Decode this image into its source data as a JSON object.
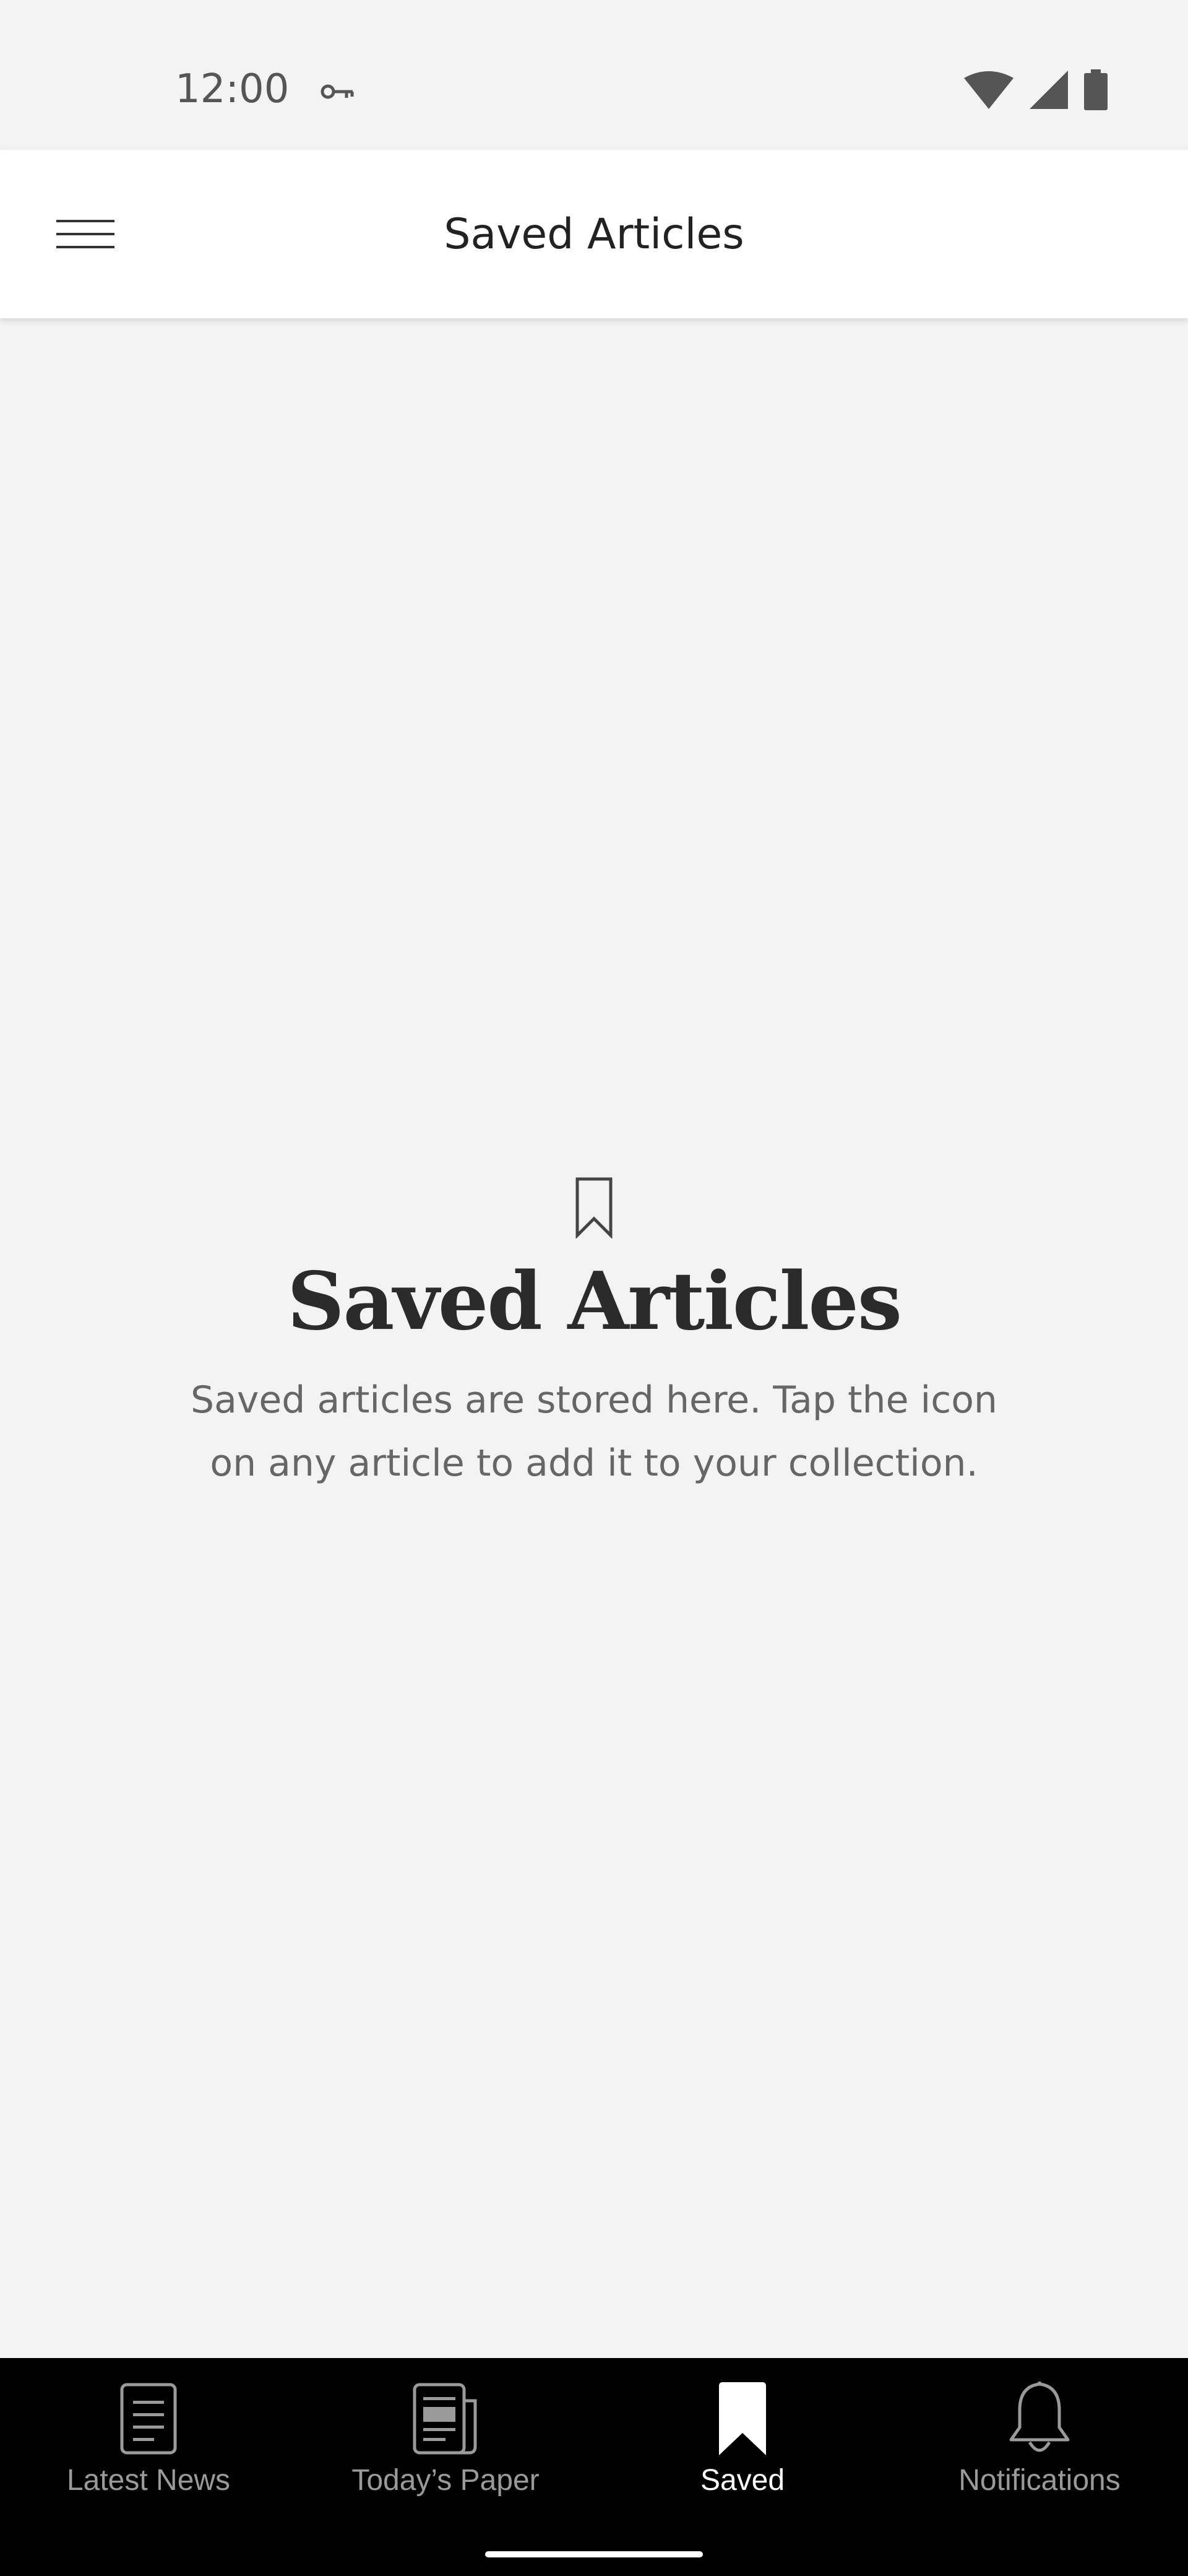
{
  "status_bar": {
    "time": "12:00",
    "icons": [
      "vpn-key-icon",
      "wifi-icon",
      "cell-signal-icon",
      "battery-icon"
    ]
  },
  "app_bar": {
    "title": "Saved Articles",
    "menu_icon": "hamburger-menu-icon"
  },
  "empty_state": {
    "icon": "bookmark-outline-icon",
    "title": "Saved Articles",
    "description": "Saved articles are stored here. Tap the icon on any article to add it to your collection."
  },
  "bottom_nav": {
    "active": "Saved",
    "items": [
      {
        "label": "Latest News",
        "icon": "document-icon"
      },
      {
        "label": "Today’s Paper",
        "icon": "newspaper-icon"
      },
      {
        "label": "Saved",
        "icon": "bookmark-filled-icon"
      },
      {
        "label": "Notifications",
        "icon": "bell-icon"
      }
    ]
  },
  "colors": {
    "background": "#f3f3f3",
    "app_bar": "#ffffff",
    "nav_background": "#000000",
    "nav_active": "#ffffff",
    "nav_inactive": "#9a9a9a",
    "title_text": "#2b2b2b",
    "body_text": "#666666"
  }
}
